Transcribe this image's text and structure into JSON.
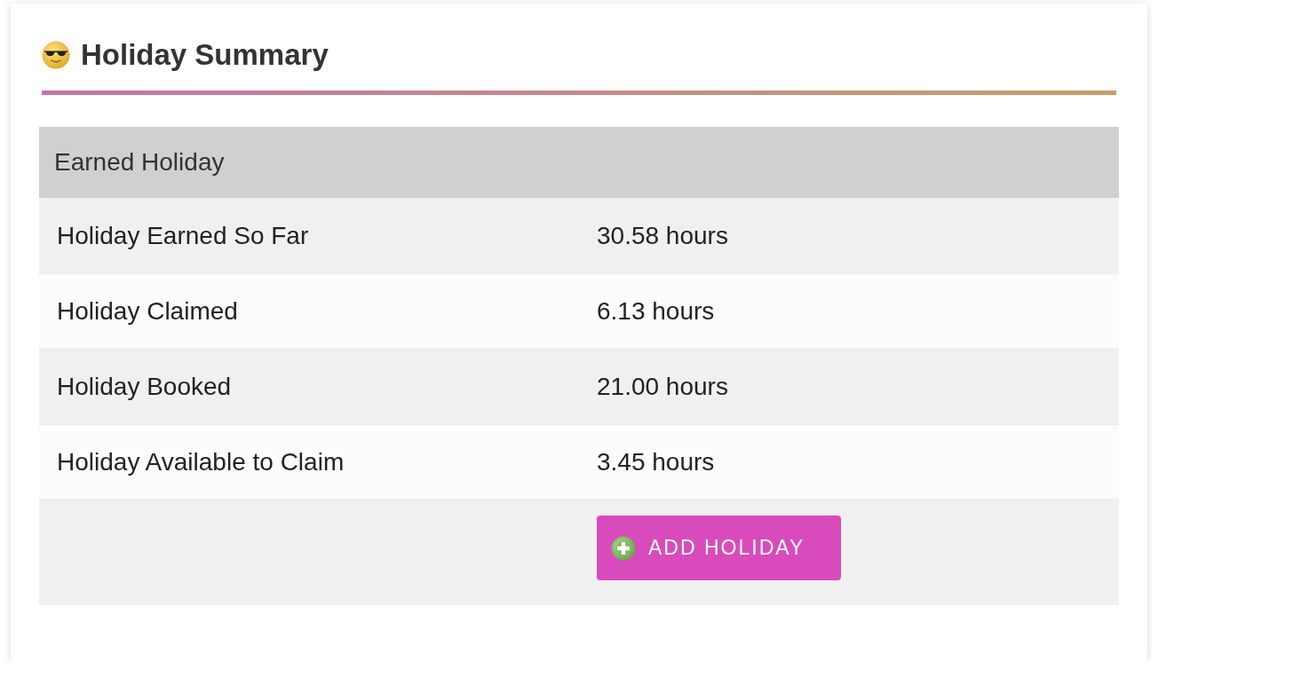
{
  "card": {
    "title": "Holiday Summary"
  },
  "table": {
    "header": "Earned Holiday",
    "rows": [
      {
        "label": "Holiday Earned So Far",
        "value": "30.58 hours"
      },
      {
        "label": "Holiday Claimed",
        "value": "6.13 hours"
      },
      {
        "label": "Holiday Booked",
        "value": "21.00 hours"
      },
      {
        "label": "Holiday Available to Claim",
        "value": "3.45 hours"
      }
    ],
    "action": {
      "label": "ADD HOLIDAY"
    }
  }
}
